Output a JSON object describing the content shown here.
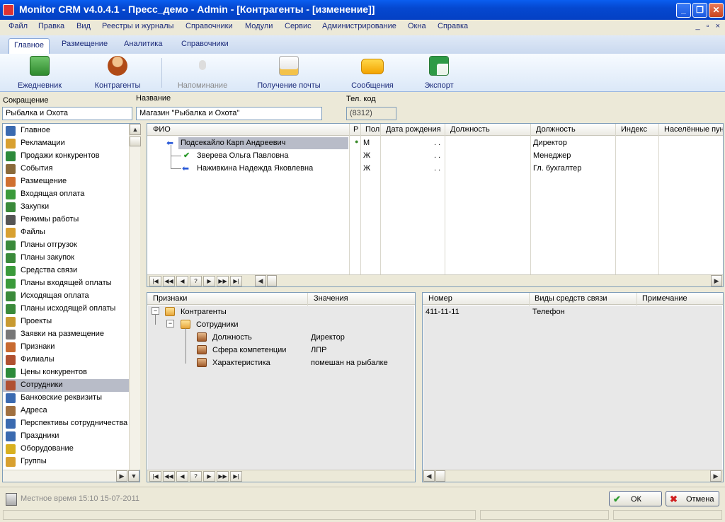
{
  "window": {
    "title": "Monitor CRM v4.0.4.1 - Пресс_демо - Admin - [Контрагенты - [изменение]]",
    "mdi_controls": "_ ▫ ×"
  },
  "menu": [
    "Файл",
    "Правка",
    "Вид",
    "Реестры и журналы",
    "Справочники",
    "Модули",
    "Сервис",
    "Администрирование",
    "Окна",
    "Справка"
  ],
  "ribbon_tabs": [
    "Главное",
    "Размещение",
    "Аналитика",
    "Справочники"
  ],
  "ribbon_buttons": [
    {
      "label": "Ежедневник",
      "icon": "notebook-icon"
    },
    {
      "label": "Контрагенты",
      "icon": "person-icon"
    },
    {
      "label": "Напоминание",
      "icon": "bulb-icon"
    },
    {
      "label": "Получение почты",
      "icon": "mail-icon"
    },
    {
      "label": "Сообщения",
      "icon": "chat-icon"
    },
    {
      "label": "Экспорт",
      "icon": "excel-icon"
    }
  ],
  "fields": {
    "short_label": "Сокращение",
    "short_value": "Рыбалка и Охота",
    "name_label": "Название",
    "name_value": "Магазин \"Рыбалка и Охота\"",
    "code_label": "Тел. код",
    "code_value": "(8312)"
  },
  "nav_items": [
    "Главное",
    "Рекламации",
    "Продажи конкурентов",
    "События",
    "Размещение",
    "Входящая оплата",
    "Закупки",
    "Режимы работы",
    "Файлы",
    "Планы отгрузок",
    "Планы закупок",
    "Средства связи",
    "Планы входящей оплаты",
    "Исходящая оплата",
    "Планы исходящей оплаты",
    "Проекты",
    "Заявки на размещение",
    "Признаки",
    "Филиалы",
    "Цены конкурентов",
    "Сотрудники",
    "Банковские реквизиты",
    "Адреса",
    "Перспективы сотрудничества",
    "Праздники",
    "Оборудование",
    "Группы"
  ],
  "nav_selected": "Сотрудники",
  "employees": {
    "headers": [
      "ФИО",
      "Р",
      "Пол",
      "Дата рождения",
      "Должность",
      "Должность",
      "Индекс",
      "Населённые пун"
    ],
    "rows": [
      {
        "fio": "Подсекайло Карп Андреевич",
        "r": "●",
        "sex": "М",
        "dob": ". .",
        "pos1": "",
        "pos2": "Директор"
      },
      {
        "fio": "Зверева Ольга Павловна",
        "r": "",
        "sex": "Ж",
        "dob": ". .",
        "pos1": "",
        "pos2": "Менеджер"
      },
      {
        "fio": "Наживкина Надежда Яковлевна",
        "r": "",
        "sex": "Ж",
        "dob": ". .",
        "pos1": "",
        "pos2": "Гл. бухгалтер"
      }
    ]
  },
  "attributes": {
    "headers": [
      "Признаки",
      "Значения"
    ],
    "tree": [
      {
        "label": "Контрагенты",
        "value": "",
        "level": 0
      },
      {
        "label": "Сотрудники",
        "value": "",
        "level": 1
      },
      {
        "label": "Должность",
        "value": "Директор",
        "level": 2
      },
      {
        "label": "Сфера компетенции",
        "value": "ЛПР",
        "level": 2
      },
      {
        "label": "Характеристика",
        "value": "помешан на рыбалке",
        "level": 2
      }
    ]
  },
  "contacts": {
    "headers": [
      "Номер",
      "Виды средств связи",
      "Примечание"
    ],
    "rows": [
      {
        "number": "411-11-11",
        "type": "Телефон",
        "note": ""
      }
    ]
  },
  "nav_glyphs": [
    "|◀",
    "◀◀",
    "◀",
    "?",
    "▶",
    "▶▶",
    "▶|"
  ],
  "status": {
    "local_time": "Местное время  15:10   15-07-2011"
  },
  "buttons": {
    "ok": "ОК",
    "cancel": "Отмена"
  },
  "colors": {
    "titlebar": "#0548d0",
    "selection": "#b8bcc8",
    "menu_text": "#1b2a7a"
  }
}
